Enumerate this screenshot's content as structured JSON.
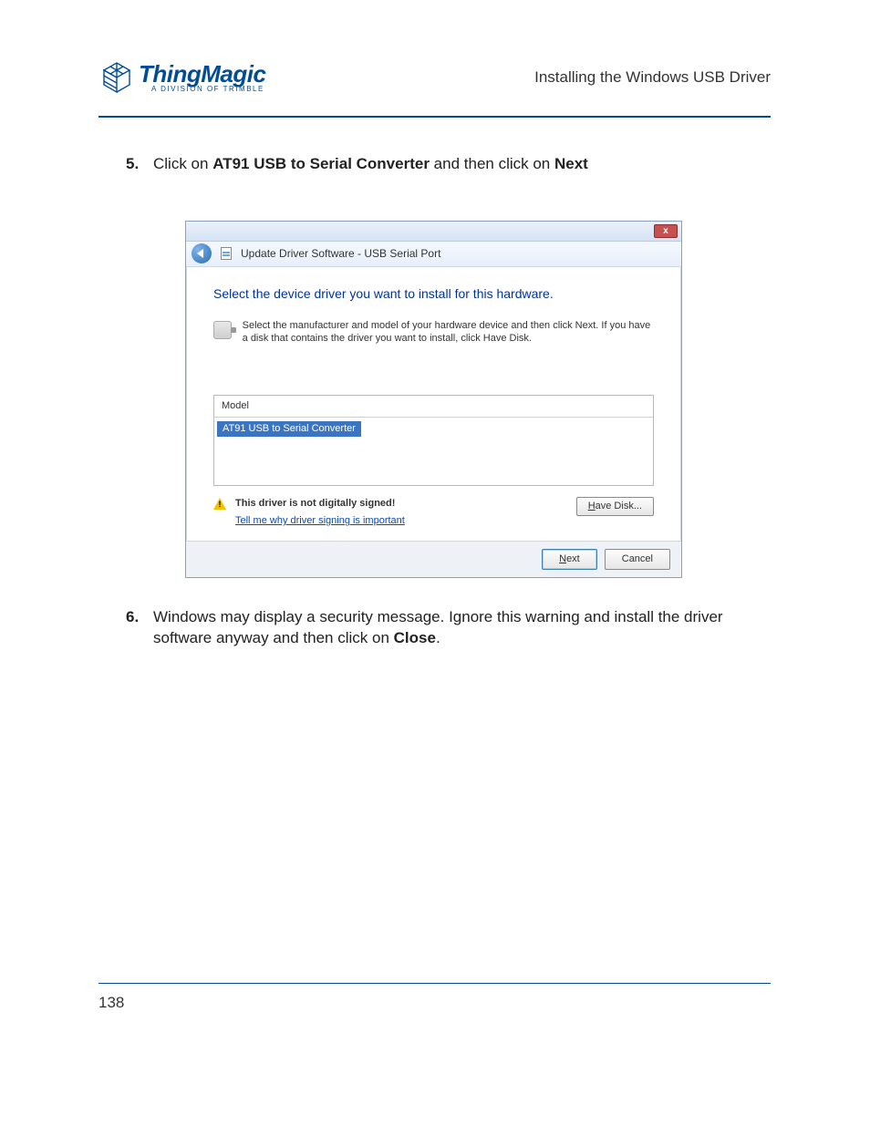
{
  "header": {
    "logo_main": "ThingMagic",
    "logo_sub": "A DIVISION OF TRIMBLE",
    "doc_title": "Installing the Windows USB Driver"
  },
  "steps": {
    "s5": {
      "num": "5.",
      "t1": "Click on ",
      "b1": "AT91 USB to Serial Converter",
      "t2": " and then click on ",
      "b2": "Next"
    },
    "s6": {
      "num": "6.",
      "t1": "Windows may display a security message. Ignore this warning and install the driver software anyway and then click on ",
      "b1": "Close",
      "t2": "."
    }
  },
  "dialog": {
    "crumb": "Update Driver Software - USB Serial Port",
    "heading": "Select the device driver you want to install for this hardware.",
    "desc": "Select the manufacturer and model of your hardware device and then click Next. If you have a disk that contains the driver you want to install, click Have Disk.",
    "model_label": "Model",
    "model_item": "AT91 USB to Serial Converter",
    "warn_bold": "This driver is not digitally signed!",
    "warn_link": "Tell me why driver signing is important",
    "have_disk_pre": "H",
    "have_disk_rest": "ave Disk...",
    "next_pre": "N",
    "next_rest": "ext",
    "cancel": "Cancel",
    "close_x": "x"
  },
  "page_number": "138"
}
